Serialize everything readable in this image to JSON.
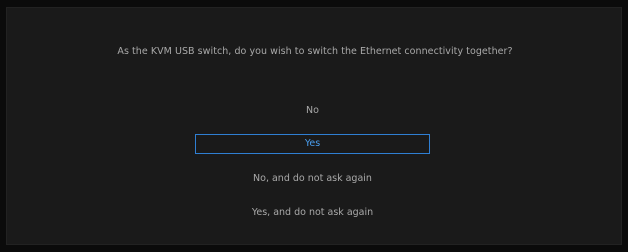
{
  "dialog": {
    "question": "As the KVM USB switch, do you wish to switch the Ethernet connectivity together?",
    "options": [
      {
        "label": "No",
        "selected": false
      },
      {
        "label": "Yes",
        "selected": true
      },
      {
        "label": "No, and do not ask again",
        "selected": false
      },
      {
        "label": "Yes, and do not ask again",
        "selected": false
      }
    ]
  },
  "colors": {
    "background": "#0b0b0b",
    "panel": "#1a1a1a",
    "text": "#a9a9a9",
    "accent": "#2f7fd3",
    "accent_text": "#4a9ff0"
  }
}
